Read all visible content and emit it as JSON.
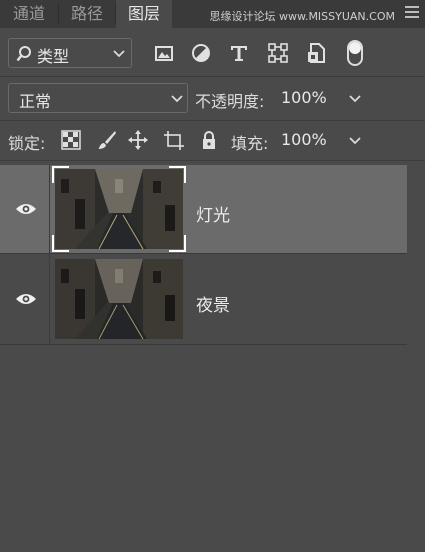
{
  "tabs": [
    {
      "label": "通道",
      "active": false
    },
    {
      "label": "路径",
      "active": false
    },
    {
      "label": "图层",
      "active": true
    }
  ],
  "watermark": "思缘设计论坛 www.MISSYUAN.COM",
  "filter": {
    "kind_label": "类型",
    "icons": [
      "image-filter-icon",
      "adjustment-filter-icon",
      "type-filter-icon",
      "shape-filter-icon",
      "smart-object-filter-icon"
    ],
    "toggle_on": true
  },
  "blend": {
    "mode": "正常",
    "opacity_label": "不透明度:",
    "opacity_value": "100%"
  },
  "lock": {
    "label": "锁定:",
    "fill_label": "填充:",
    "fill_value": "100%"
  },
  "layers": [
    {
      "name": "灯光",
      "visible": true,
      "selected": true
    },
    {
      "name": "夜景",
      "visible": true,
      "selected": false
    }
  ],
  "colors": {
    "panel_bg": "#4a4a4a",
    "tabbar_bg": "#3a3a3a",
    "selected_row": "#6b6b6b"
  }
}
